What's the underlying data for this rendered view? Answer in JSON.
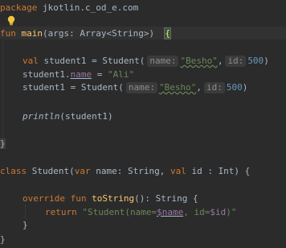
{
  "editor": {
    "theme_colors": {
      "background": "#2b2b2b",
      "keyword": "#cc7832",
      "function": "#ffc66d",
      "string": "#6a8759",
      "number": "#6897bb",
      "property": "#9876aa",
      "text": "#a9b7c6"
    },
    "intention_icon": "lightbulb-icon",
    "line1": {
      "kw": "package",
      "text": " jkotlin.c_od_e.com"
    },
    "line2": {
      "kw": "fun",
      "fn": "main",
      "rest": "(args: Array<String>)",
      "brace": "{"
    },
    "line3": {
      "kw": "val",
      "a": " student1 = Student(",
      "hint1": "name:",
      "str1": "\"Besho\"",
      "comma": ",",
      "hint2": "id:",
      "num1": "500",
      "close": ")"
    },
    "line4": {
      "a": "student1.",
      "prop": "name",
      "eq": " = ",
      "str": "\"Ali\""
    },
    "line5": {
      "a": "student1 = Student(",
      "hint1": "name:",
      "str1": "\"Besho\"",
      "comma": ",",
      "hint2": "id:",
      "num1": "500",
      "close": ")"
    },
    "line6": {
      "fn": "println",
      "rest": "(student1)"
    },
    "line7": {
      "brace": "}"
    },
    "line8": {
      "kw1": "class",
      "a": " Student(",
      "kw2": "var",
      "b": " name: String, ",
      "kw3": "val",
      "c": " id : Int) {"
    },
    "line9": {
      "kw1": "override",
      "kw2": "fun",
      "fn": "toString",
      "rest": "(): String {"
    },
    "line10": {
      "kw": "return",
      "s1": "\"Student(name=",
      "t1": "$name",
      "s2": ", id=",
      "t2": "$id",
      "s3": ")\""
    },
    "line11": {
      "brace": "}"
    },
    "line12": {
      "brace": "}"
    }
  }
}
